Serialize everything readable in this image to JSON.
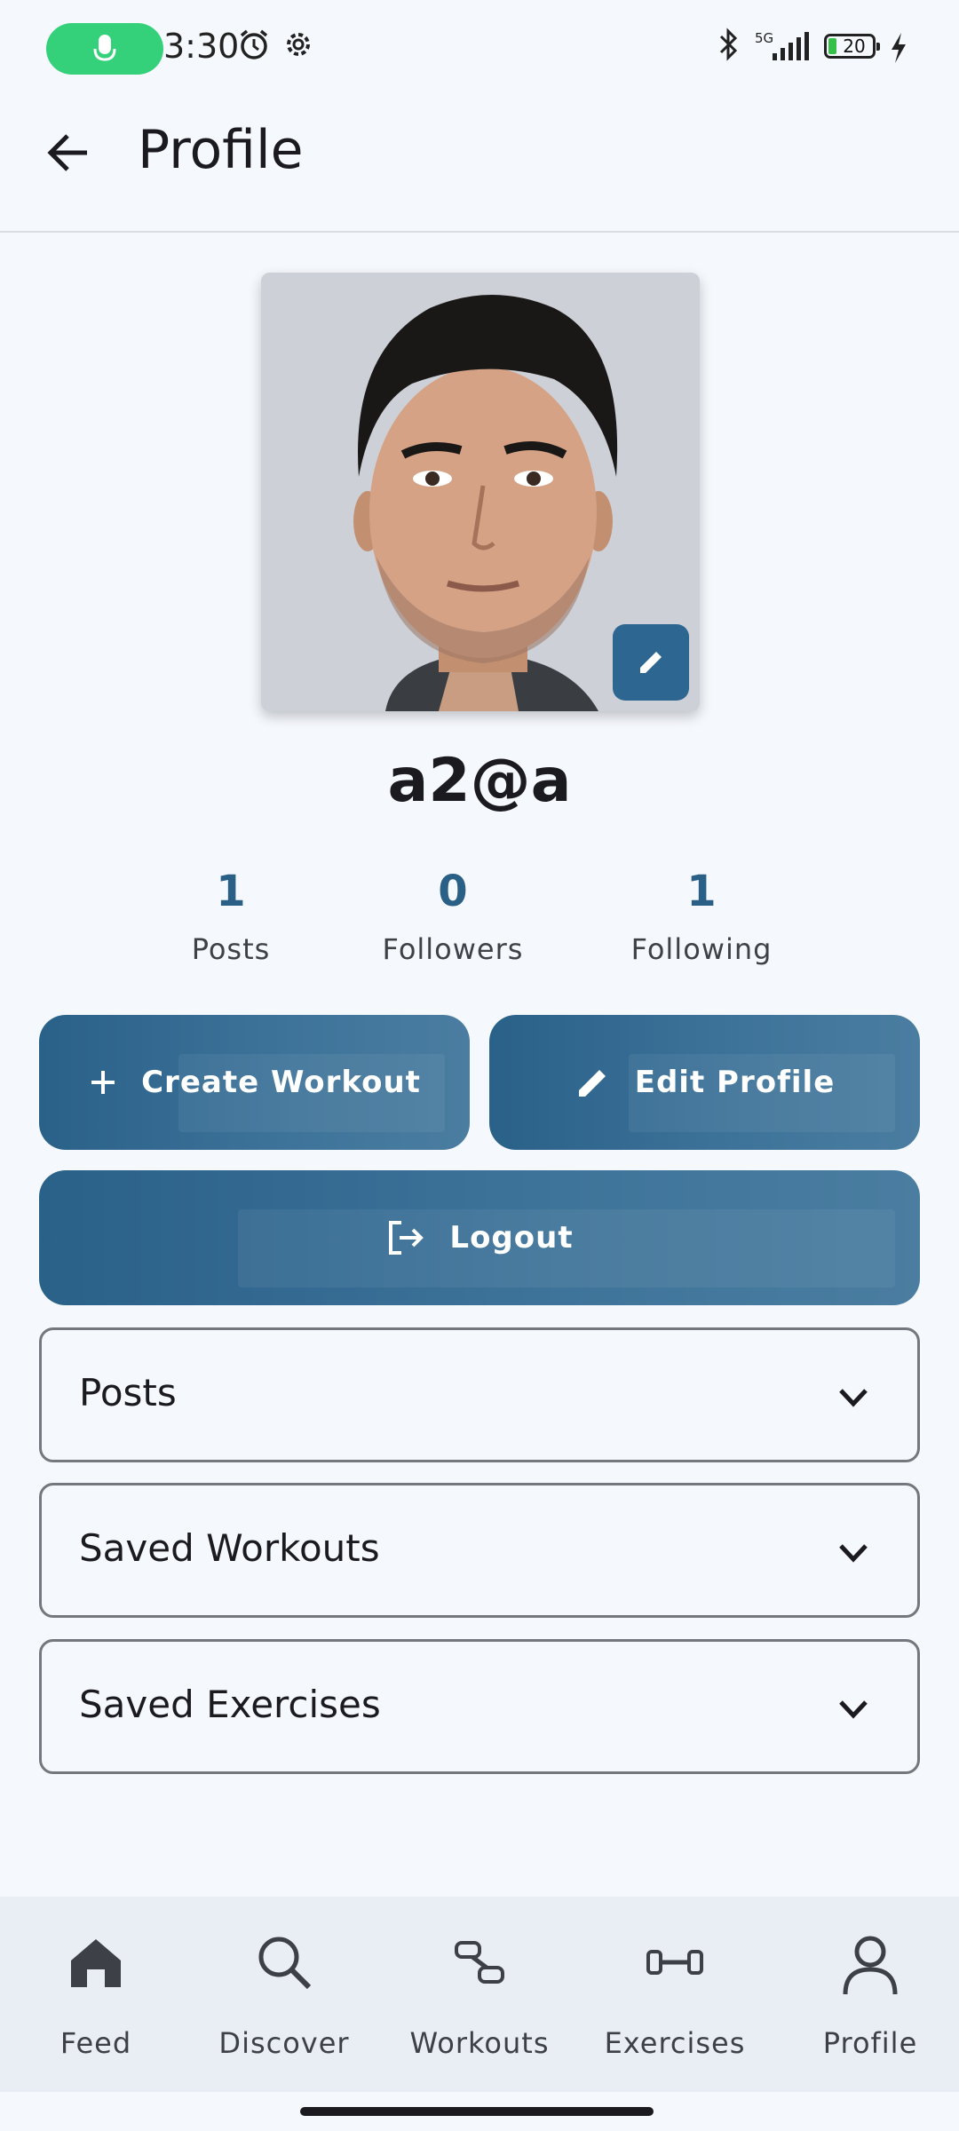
{
  "status_bar": {
    "time": "3:30",
    "battery": "20",
    "network": "5G"
  },
  "app_bar": {
    "title": "Profile"
  },
  "profile": {
    "username": "a2@a",
    "stats": [
      {
        "value": "1",
        "label": "Posts"
      },
      {
        "value": "0",
        "label": "Followers"
      },
      {
        "value": "1",
        "label": "Following"
      }
    ]
  },
  "actions": {
    "create_workout": "Create Workout",
    "edit_profile": "Edit Profile",
    "logout": "Logout"
  },
  "sections": [
    {
      "label": "Posts"
    },
    {
      "label": "Saved Workouts"
    },
    {
      "label": "Saved Exercises"
    }
  ],
  "nav": [
    {
      "label": "Feed",
      "icon": "home-icon"
    },
    {
      "label": "Discover",
      "icon": "search-icon"
    },
    {
      "label": "Workouts",
      "icon": "dumbbell-icon"
    },
    {
      "label": "Exercises",
      "icon": "barbell-icon"
    },
    {
      "label": "Profile",
      "icon": "person-icon"
    }
  ],
  "colors": {
    "primary": "#2d6690",
    "stat_number": "#2a5f86",
    "background": "#f5f8fd",
    "nav_background": "#e9edf4"
  }
}
